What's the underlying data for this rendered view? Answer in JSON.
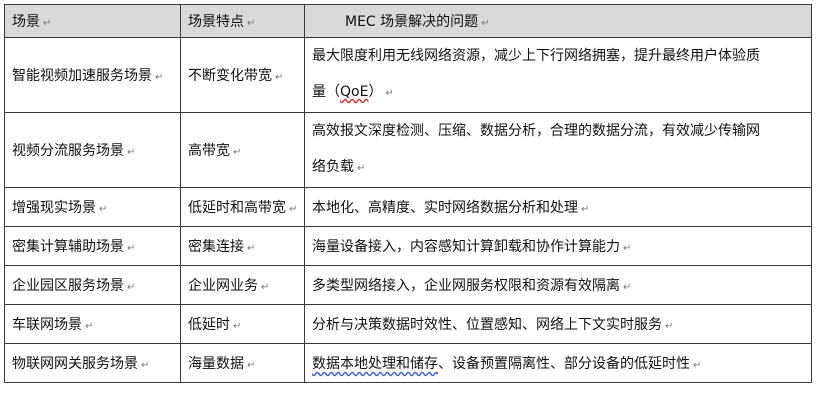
{
  "header": {
    "col_scene": "场景",
    "col_feature": "场景特点",
    "col_issue": "MEC 场景解决的问题"
  },
  "paragraph_mark": "↵",
  "rows": [
    {
      "scene": "智能视频加速服务场景",
      "feature": "不断变化带宽",
      "issue_line1": "最大限度利用无线网络资源，减少上下行网络拥塞，提升最终用户体验质",
      "issue_line2_prefix": "量（",
      "issue_line2_term": "QoE",
      "issue_line2_suffix": "）"
    },
    {
      "scene": "视频分流服务场景",
      "feature": "高带宽",
      "issue_line1": "高效报文深度检测、压缩、数据分析，合理的数据分流，有效减少传输网",
      "issue_line2": "络负载"
    },
    {
      "scene": "增强现实场景",
      "feature": "低延时和高带宽",
      "issue": "本地化、高精度、实时网络数据分析和处理"
    },
    {
      "scene": "密集计算辅助场景",
      "feature": "密集连接",
      "issue": "海量设备接入，内容感知计算卸载和协作计算能力"
    },
    {
      "scene": "企业园区服务场景",
      "feature": "企业网业务",
      "issue": "多类型网络接入，企业网服务权限和资源有效隔离"
    },
    {
      "scene": "车联网场景",
      "feature": "低延时",
      "issue": "分析与决策数据时效性、位置感知、网络上下文实时服务"
    },
    {
      "scene": "物联网网关服务场景",
      "feature": "海量数据",
      "issue_underlined": "数据本地处理和储存",
      "issue_rest": "、设备预置隔离性、部分设备的低延时性"
    }
  ]
}
